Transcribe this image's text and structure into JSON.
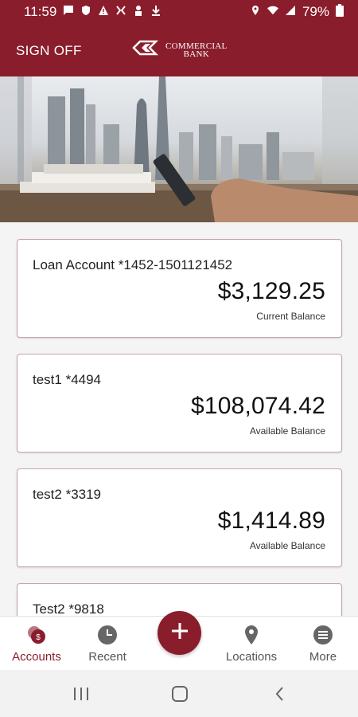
{
  "status_bar": {
    "time": "11:59",
    "battery": "79%",
    "left_icons": [
      "message-icon",
      "shield-icon",
      "warning-icon",
      "nfc-icon",
      "person-icon",
      "download-icon"
    ],
    "right_icons": [
      "location-icon",
      "wifi-icon",
      "signal-icon",
      "battery-icon"
    ]
  },
  "header": {
    "sign_off_label": "SIGN OFF",
    "logo_line1": "COMMERCIAL",
    "logo_line2": "BANK"
  },
  "accounts": [
    {
      "name": "Loan Account *1452-1501121452",
      "amount": "$3,129.25",
      "balance_label": "Current Balance"
    },
    {
      "name": "test1 *4494",
      "amount": "$108,074.42",
      "balance_label": "Available Balance"
    },
    {
      "name": "test2 *3319",
      "amount": "$1,414.89",
      "balance_label": "Available Balance"
    },
    {
      "name": "Test2 *9818",
      "amount": "",
      "balance_label": ""
    }
  ],
  "bottom_nav": {
    "items": [
      {
        "label": "Accounts",
        "icon": "accounts-icon",
        "active": true
      },
      {
        "label": "Recent",
        "icon": "clock-icon",
        "active": false
      },
      {
        "label": "Locations",
        "icon": "location-pin-icon",
        "active": false
      },
      {
        "label": "More",
        "icon": "menu-icon",
        "active": false
      }
    ],
    "fab_icon": "plus-icon"
  },
  "system_nav": [
    "recents-icon",
    "home-icon",
    "back-icon"
  ],
  "colors": {
    "brand": "#8a1d2c",
    "card_border": "#c7a5aa",
    "background": "#f4f4f4",
    "nav_inactive": "#555555"
  }
}
